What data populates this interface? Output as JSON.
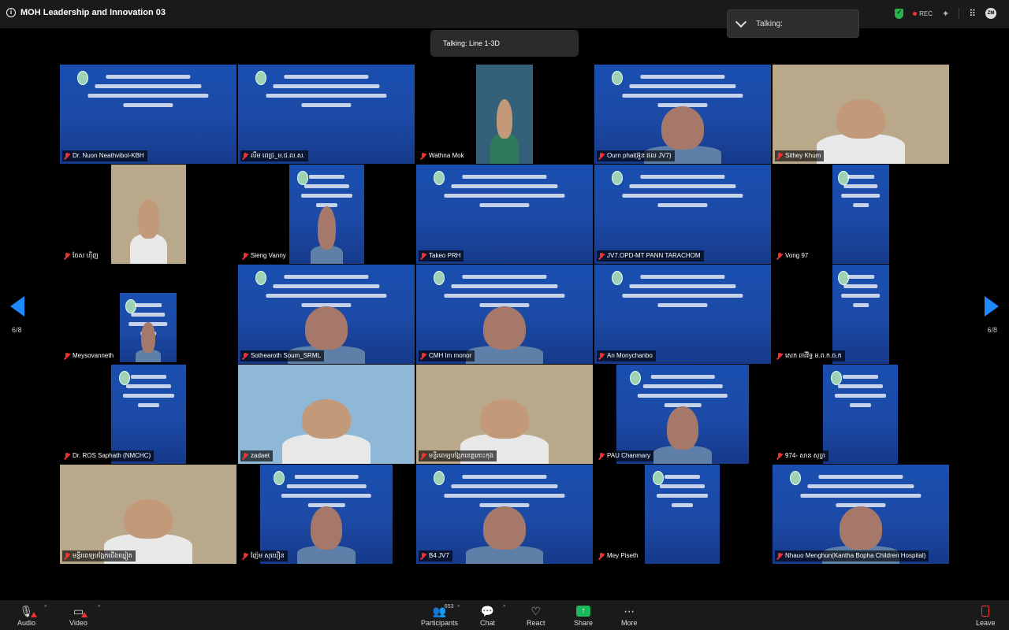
{
  "meeting": {
    "title": "MOH Leadership and Innovation 03",
    "rec_label": "REC"
  },
  "talking_pill": "Talking: Line 1-3D",
  "talking_panel": "Talking:",
  "pagination": {
    "left": "6/8",
    "right": "6/8"
  },
  "tiles": [
    {
      "name": "Dr. Nuon Neathvibol-KBH"
    },
    {
      "name": "លឹម ពេជ្រ_ម.ជ.ល.ស."
    },
    {
      "name": "Wathna Mok"
    },
    {
      "name": "Ourn phal(អ៊ួន ផល JV7)"
    },
    {
      "name": "Sithey Khum"
    },
    {
      "name": "ចែស ហ៊ីញ"
    },
    {
      "name": "Sieng Vanny"
    },
    {
      "name": "Takeo PRH"
    },
    {
      "name": "JV7.OPD-MT PANN TARACHOM"
    },
    {
      "name": "Vong 97"
    },
    {
      "name": "Meysovanneth"
    },
    {
      "name": "Sothearoth Soum_SRML"
    },
    {
      "name": "CMH Im monor"
    },
    {
      "name": "An Monychanbo"
    },
    {
      "name": "សេក ឆាវីវិទ្ធ ម.ព.ក.ច.ក"
    },
    {
      "name": "Dr. ROS Saphath (NMCHC)"
    },
    {
      "name": "zadaet"
    },
    {
      "name": "មន្ទីរពេទ្យបង្អែកខេត្តកោះកុង"
    },
    {
      "name": "PAU Chanmary"
    },
    {
      "name": "974- សាន សុច្ចា"
    },
    {
      "name": "មន្ទីរពេទ្យបង្អែកជើងឃ្នៀត"
    },
    {
      "name": "ញ៉ែម សុឃឿន"
    },
    {
      "name": "B4 JV7"
    },
    {
      "name": "Mey Piseth"
    },
    {
      "name": "Nhauo Menghun(Kantha Bopha Children Hospital)"
    }
  ],
  "toolbar": {
    "audio": "Audio",
    "video": "Video",
    "participants": "Participants",
    "participants_count": "653",
    "chat": "Chat",
    "react": "React",
    "share": "Share",
    "more": "More",
    "leave": "Leave"
  }
}
